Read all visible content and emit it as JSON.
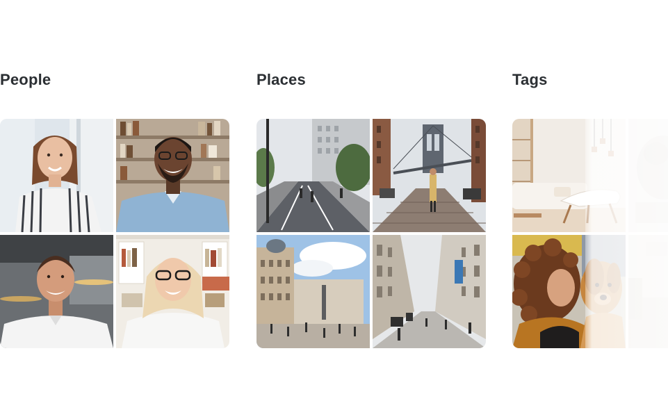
{
  "albums": [
    {
      "id": "people",
      "title": "People"
    },
    {
      "id": "places",
      "title": "Places"
    },
    {
      "id": "tags",
      "title": "Tags"
    }
  ],
  "colors": {
    "title_text": "#2b2f33",
    "background": "#ffffff"
  }
}
